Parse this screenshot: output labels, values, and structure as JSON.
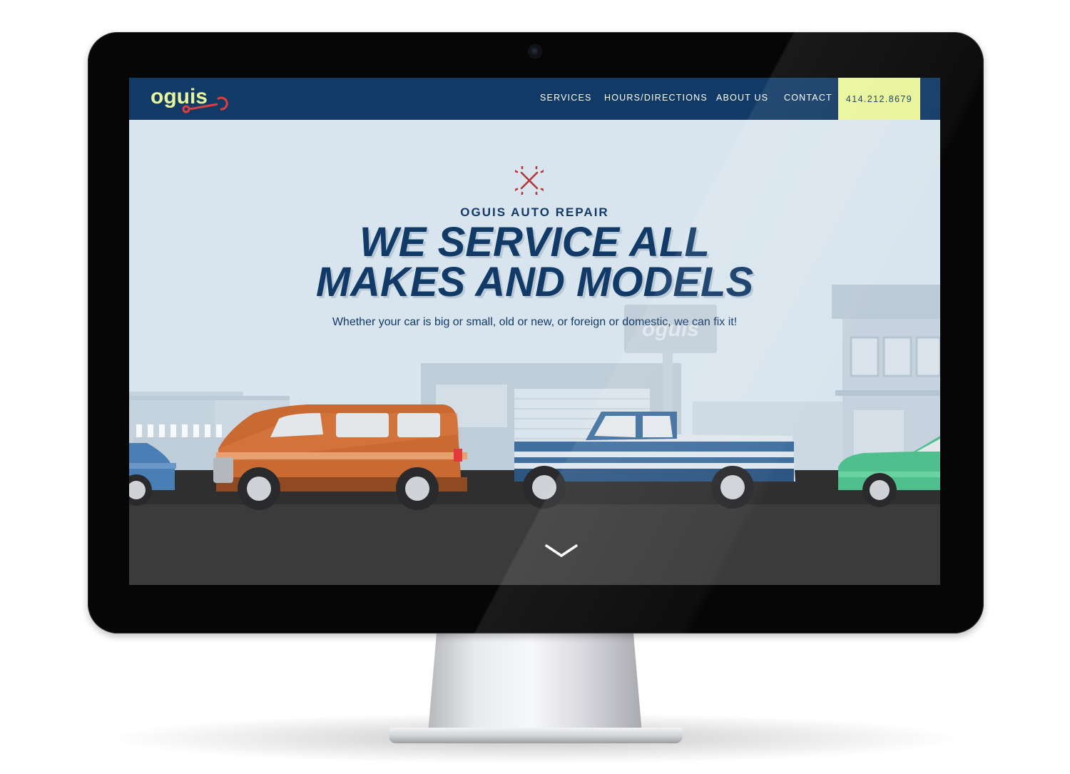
{
  "brand": {
    "logo_text": "oguis"
  },
  "nav": {
    "items": [
      {
        "label": "SERVICES"
      },
      {
        "label": "HOURS/DIRECTIONS"
      },
      {
        "label": "ABOUT US"
      },
      {
        "label": "CONTACT"
      }
    ],
    "phone": "414.212.8679"
  },
  "hero": {
    "kicker": "OGUIS AUTO REPAIR",
    "title_line1": "WE SERVICE ALL",
    "title_line2": "MAKES AND MODELS",
    "subtitle": "Whether your car is big or small, old or new, or foreign or domestic, we can fix it!"
  },
  "scene": {
    "sign_text": "oguis"
  },
  "icons": {
    "hero_icon": "crossed-wrenches-icon",
    "scroll": "chevron-down-icon"
  },
  "colors": {
    "navy": "#123a66",
    "phone_bg": "#e9f59a",
    "sky": "#d9e5ee",
    "road": "#3b3b3c",
    "van": "#c96a33",
    "truck": "#3f6f9f",
    "green_car": "#4fc08d"
  }
}
